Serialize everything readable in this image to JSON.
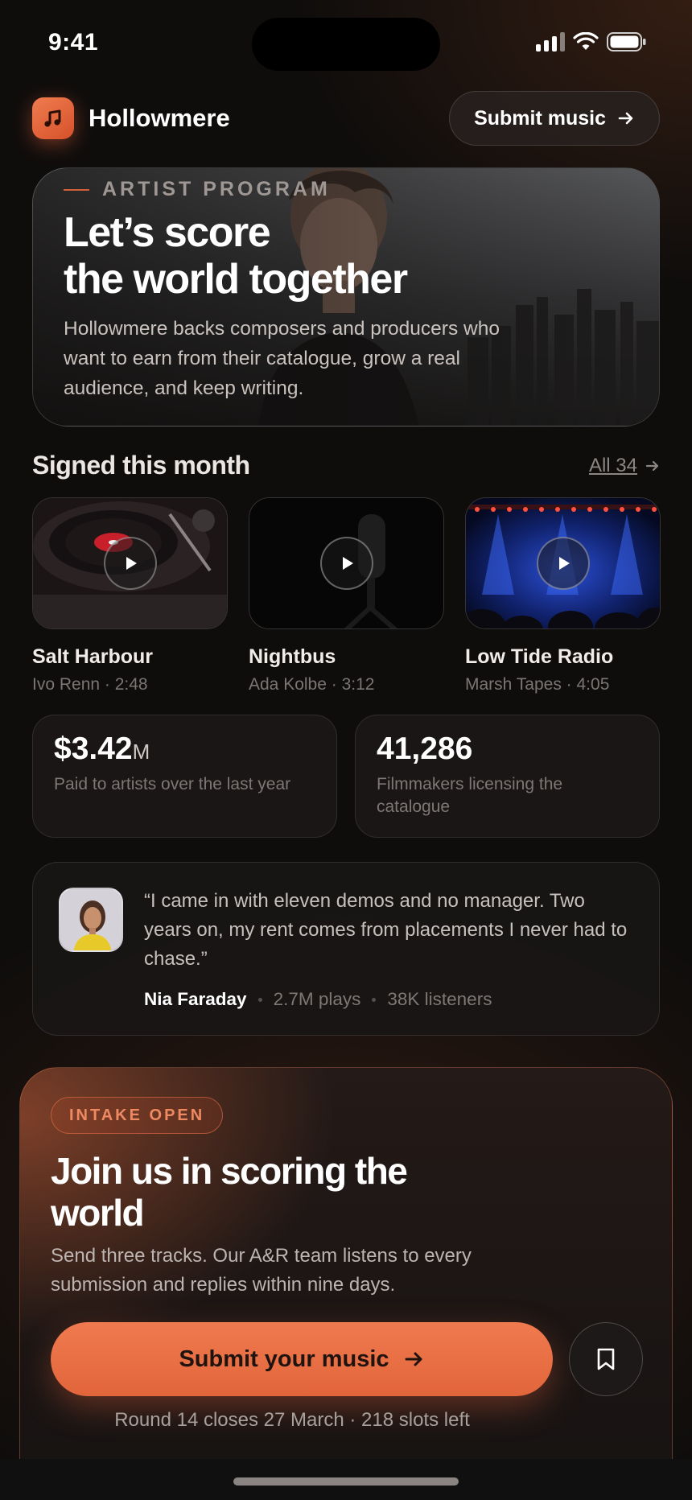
{
  "status_bar": {
    "time": "9:41"
  },
  "header": {
    "brand_name": "Hollowmere",
    "submit_label": "Submit music"
  },
  "hero": {
    "eyebrow": "ARTIST PROGRAM",
    "title_line1": "Let’s score",
    "title_line2": "the world together",
    "body": "Hollowmere backs composers and producers who want to earn from their catalogue, grow a real audience, and keep writing."
  },
  "signed": {
    "title": "Signed this month",
    "all_link": "All 34",
    "tracks": [
      {
        "title": "Salt Harbour",
        "artist": "Ivo Renn",
        "duration": "2:48",
        "meta": "Ivo Renn · 2:48"
      },
      {
        "title": "Nightbus",
        "artist": "Ada Kolbe",
        "duration": "3:12",
        "meta": "Ada Kolbe · 3:12"
      },
      {
        "title": "Low Tide Radio",
        "artist": "Marsh Tapes",
        "duration": "4:05",
        "meta": "Marsh Tapes · 4:05"
      }
    ]
  },
  "stats": [
    {
      "value": "$3.42",
      "unit": "M",
      "label": "Paid to artists over the last year"
    },
    {
      "value": "41,286",
      "unit": "",
      "label": "Filmmakers licensing the catalogue"
    }
  ],
  "testimonial": {
    "quote": "“I came in with eleven demos and no manager. Two years on, my rent comes from placements I never had to chase.”",
    "name": "Nia Faraday",
    "plays": "2.7M plays",
    "listeners": "38K listeners"
  },
  "cta": {
    "badge": "INTAKE OPEN",
    "title": "Join us in scoring the world",
    "body": "Send three tracks. Our A&R team listens to every submission and replies within nine days.",
    "button_label": "Submit your music",
    "footnote": "Round 14 closes 27 March · 218 slots left"
  },
  "colors": {
    "accent": "#E9693F",
    "background": "#0F0D0C"
  }
}
